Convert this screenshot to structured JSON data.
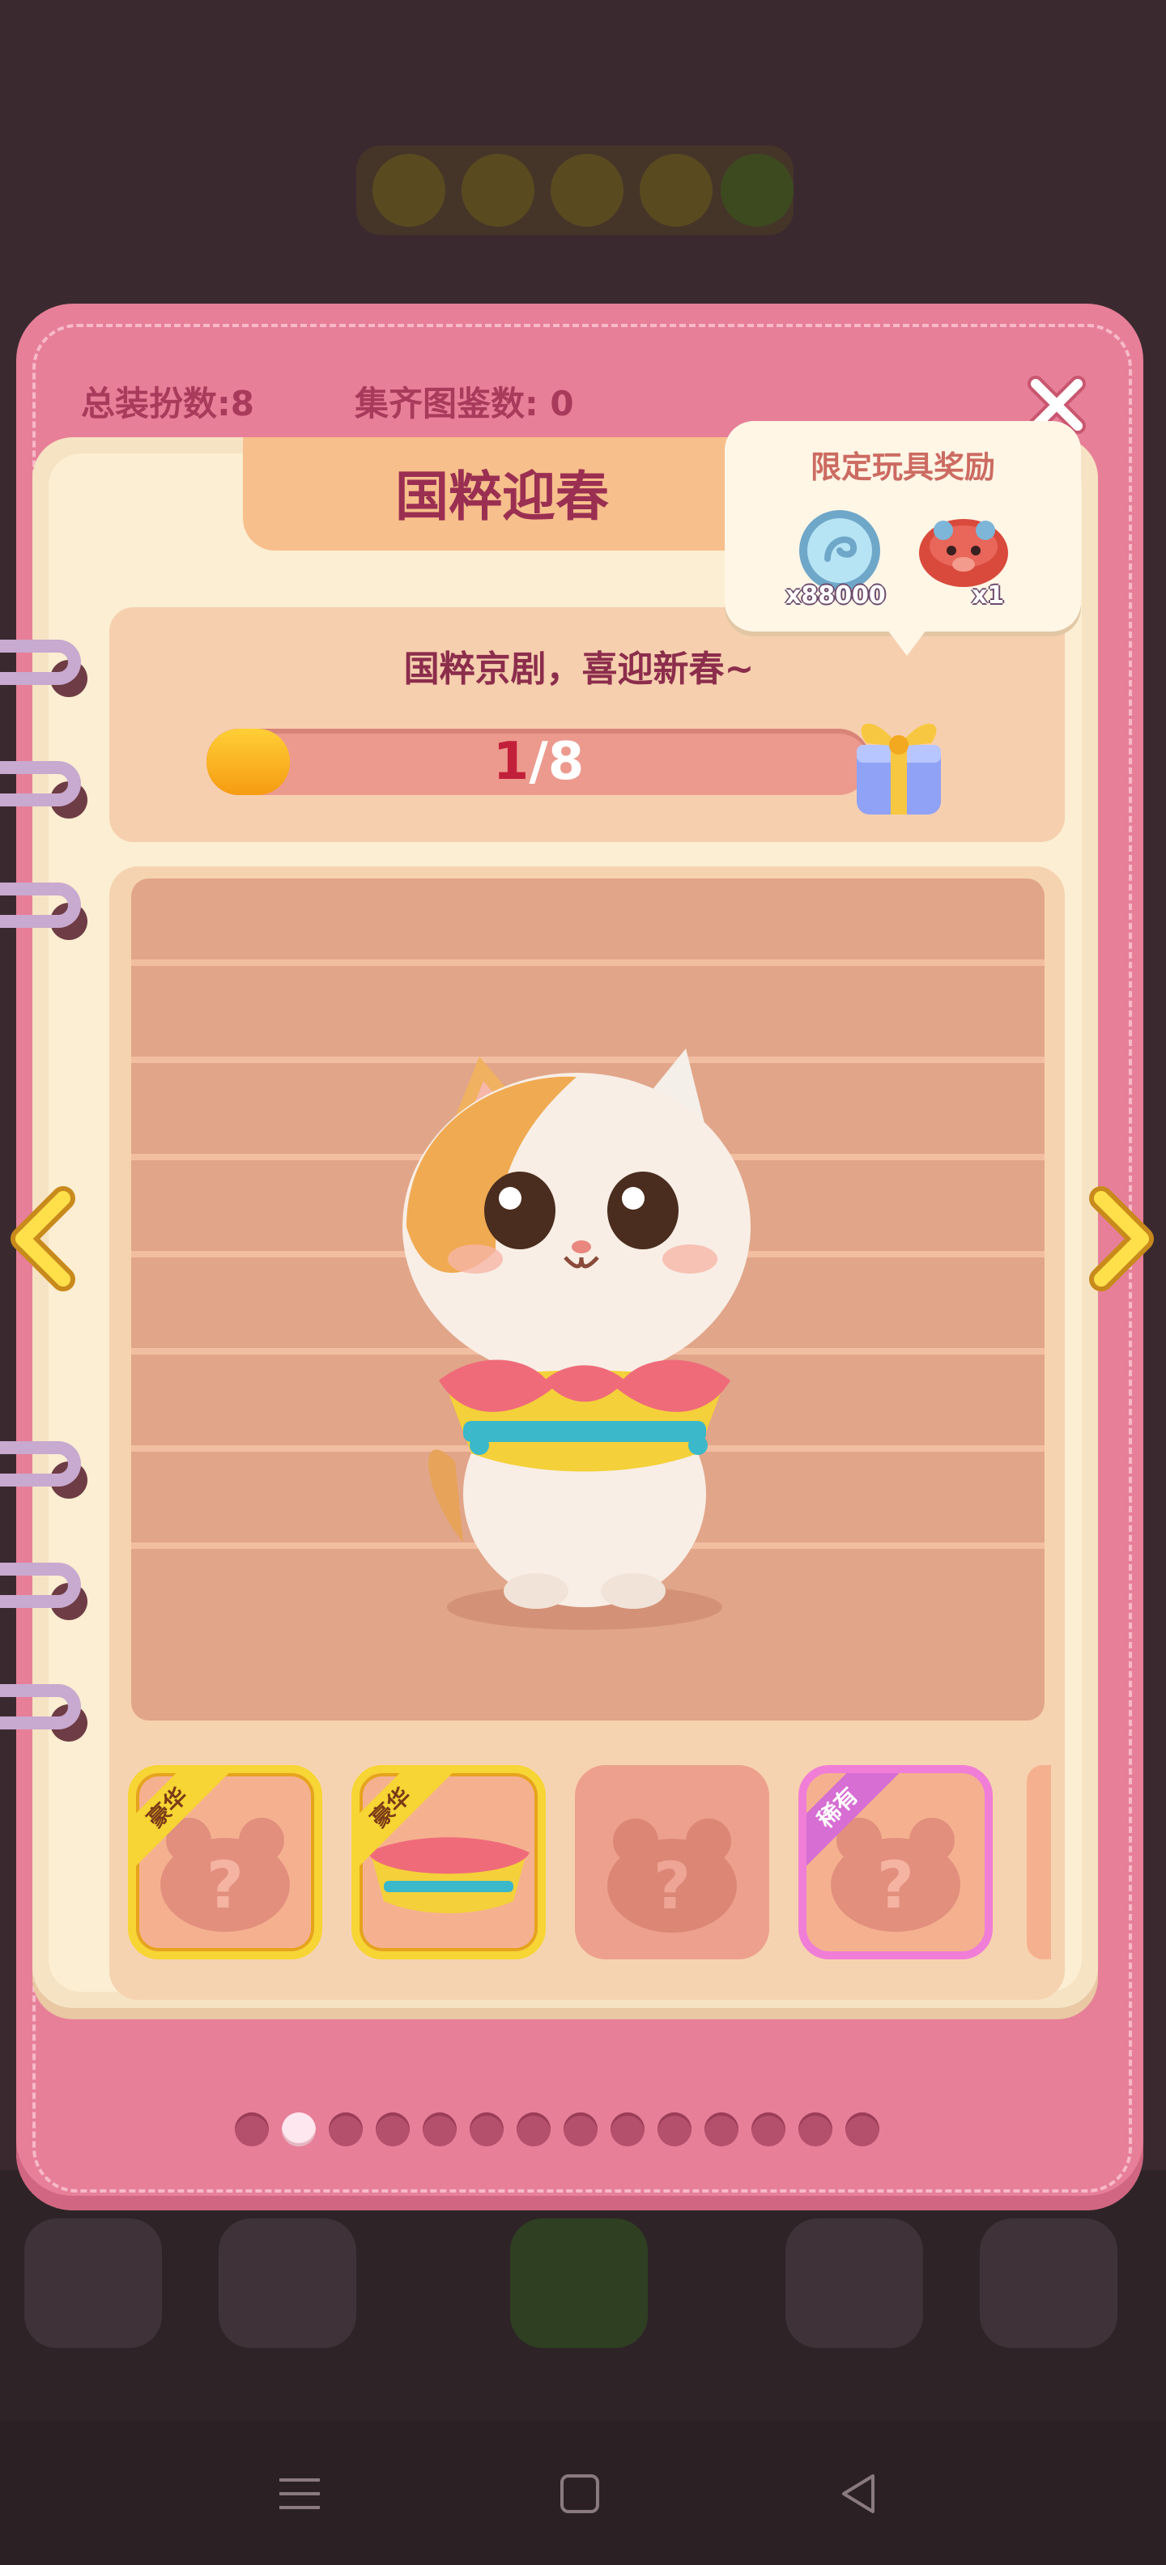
{
  "stats": {
    "total_outfits": "总装扮数:8",
    "collected_atlas": "集齐图鉴数: 0"
  },
  "book": {
    "title": "国粹迎春",
    "description": "国粹京剧，喜迎新春~",
    "progress": {
      "current": "1",
      "separator_total": "/8",
      "fraction": 0.125
    }
  },
  "reward": {
    "title": "限定玩具奖励",
    "coin_amount": "x88000",
    "toy_amount": "x1"
  },
  "slots": [
    {
      "rarity_label": "豪华",
      "state": "locked",
      "frame": "gold"
    },
    {
      "rarity_label": "豪华",
      "state": "owned",
      "frame": "gold"
    },
    {
      "rarity_label": "",
      "state": "locked",
      "frame": "plain"
    },
    {
      "rarity_label": "稀有",
      "state": "locked",
      "frame": "purple"
    }
  ],
  "pagination": {
    "pages": 14,
    "active_index": 1
  },
  "icons": {
    "close": "close-icon",
    "prev": "chevron-left-icon",
    "next": "chevron-right-icon",
    "gift": "gift-box-icon",
    "coin": "coin-icon",
    "toy": "piggy-toy-icon",
    "unknown": "question-bear-icon"
  },
  "colors": {
    "book_pink": "#e77f98",
    "paper": "#f6e3c3",
    "title_text": "#9a2f52",
    "progress_fill": "#f59b12",
    "gold_frame": "#f6d534",
    "rare_frame": "#f07ed6"
  }
}
